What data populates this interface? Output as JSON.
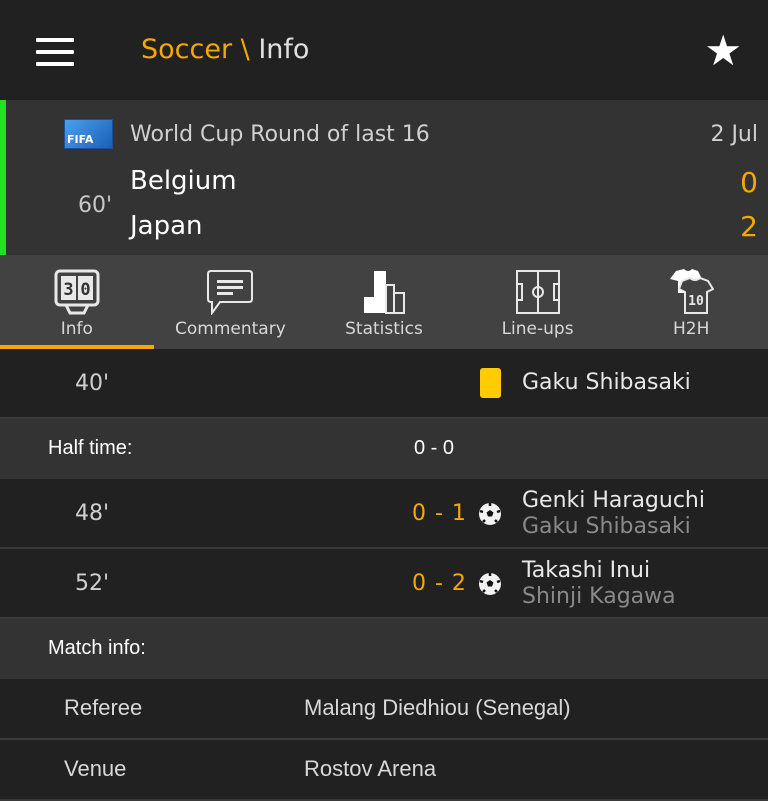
{
  "header": {
    "sport": "Soccer",
    "separator": " \\ ",
    "page": "Info",
    "menu_icon": "hamburger-menu-icon",
    "favorite_icon": "star-icon"
  },
  "match": {
    "competition_logo": "FIFA",
    "competition": "World Cup Round of last 16",
    "date": "2 Jul",
    "minute": "60'",
    "home_team": "Belgium",
    "away_team": "Japan",
    "home_score": "0",
    "away_score": "2",
    "live_indicator_color": "#22e022"
  },
  "tabs": [
    {
      "label": "Info",
      "icon": "scoreboard-icon",
      "active": true
    },
    {
      "label": "Commentary",
      "icon": "speech-bubble-icon",
      "active": false
    },
    {
      "label": "Statistics",
      "icon": "bar-chart-icon",
      "active": false
    },
    {
      "label": "Line-ups",
      "icon": "pitch-icon",
      "active": false
    },
    {
      "label": "H2H",
      "icon": "jersey-icon",
      "active": false
    }
  ],
  "events": [
    {
      "minute": "40'",
      "type": "yellow-card",
      "player": "Gaku Shibasaki"
    },
    {
      "minute": "48'",
      "type": "goal",
      "score": "0 - 1",
      "player": "Genki Haraguchi",
      "assist": "Gaku Shibasaki"
    },
    {
      "minute": "52'",
      "type": "goal",
      "score": "0 - 2",
      "player": "Takashi Inui",
      "assist": "Shinji Kagawa"
    }
  ],
  "half_time": {
    "label": "Half time:",
    "score": "0 - 0"
  },
  "match_info": {
    "label": "Match info:",
    "rows": [
      {
        "key": "Referee",
        "value": "Malang Diedhiou (Senegal)"
      },
      {
        "key": "Venue",
        "value": "Rostov Arena"
      }
    ]
  },
  "colors": {
    "accent": "#f5a800",
    "yellow_card": "#ffcc00"
  }
}
